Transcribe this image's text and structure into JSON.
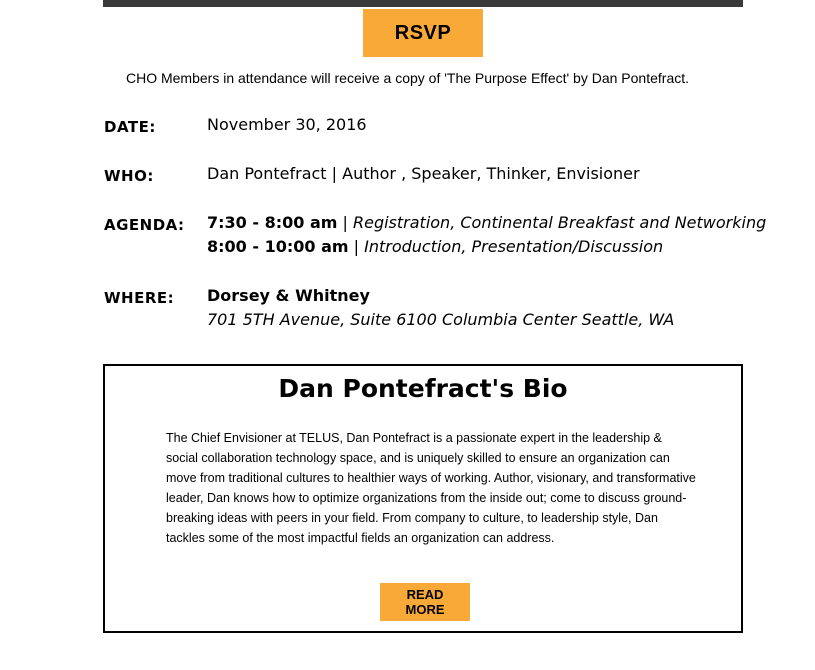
{
  "rsvp_label": "RSVP",
  "note": "CHO Members in attendance will receive a copy of 'The Purpose Effect' by Dan Pontefract.",
  "details": {
    "date": {
      "label": "DATE:",
      "value": "November 30, 2016"
    },
    "who": {
      "label": "WHO:",
      "value": "Dan Pontefract | Author , Speaker, Thinker, Envisioner"
    },
    "agenda": {
      "label": "AGENDA:",
      "items": [
        {
          "time": "7:30 - 8:00 am",
          "sep": " | ",
          "desc": "Registration, Continental Breakfast and Networking"
        },
        {
          "time": "8:00 - 10:00 am",
          "sep": " | ",
          "desc": "Introduction, Presentation/Discussion"
        }
      ]
    },
    "where": {
      "label": "WHERE:",
      "venue": "Dorsey & Whitney",
      "address": "701 5TH Avenue, Suite 6100 Columbia Center Seattle, WA"
    }
  },
  "bio": {
    "title": "Dan Pontefract's Bio",
    "text": "The Chief Envisioner at TELUS, Dan Pontefract is a passionate expert in the leadership & social collaboration technology space, and is uniquely skilled to ensure an organization can move from traditional cultures to healthier ways of working. Author, visionary, and transformative leader, Dan knows how to optimize organizations from the inside out; come to discuss ground-breaking ideas with peers in your field. From company to culture, to leadership style, Dan tackles some of the most impactful fields an organization can address.",
    "read_more_label": "READ MORE"
  },
  "colors": {
    "accent": "#f9a937",
    "border": "#000000"
  }
}
